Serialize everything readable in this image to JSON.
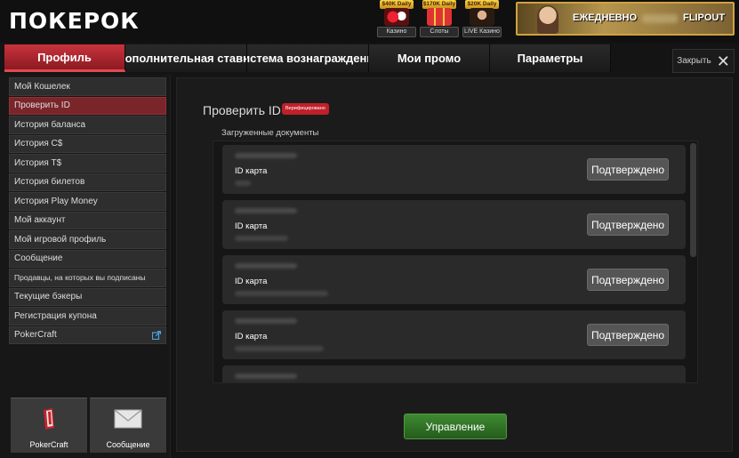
{
  "header": {
    "logo": "ПОКЕРОК",
    "games": [
      {
        "jackpot": "$40K Daily",
        "label": "Казино"
      },
      {
        "jackpot": "$170K Daily",
        "label": "Слоты"
      },
      {
        "jackpot": "$20K Daily",
        "label": "LIVE Казино"
      }
    ],
    "promo": {
      "text_left": "ЕЖЕДНЕВНО",
      "text_right": "FLIPOUT"
    }
  },
  "tabs": [
    "Профиль",
    "Дополнительная ставка",
    "Система вознаграждений",
    "Мои промо",
    "Параметры"
  ],
  "close_label": "Закрыть",
  "sidebar": {
    "items": [
      "Мой Кошелек",
      "Проверить ID",
      "История баланса",
      "История C$",
      "История T$",
      "История билетов",
      "История Play Money",
      "Мой аккаунт",
      "Мой игровой профиль",
      "Сообщение",
      "Продавцы, на которых вы подписаны",
      "Текущие бэкеры",
      "Регистрация купона",
      "PokerCraft"
    ],
    "active_index": 1,
    "shortcuts": [
      {
        "label": "PokerCraft",
        "icon": "pokercraft-icon"
      },
      {
        "label": "Сообщение",
        "icon": "envelope-icon"
      }
    ]
  },
  "main": {
    "title": "Проверить ID",
    "badge": "Верифицировано",
    "docs_label": "Загруженные документы",
    "documents": [
      {
        "type": "ID карта",
        "status": "Подтверждено"
      },
      {
        "type": "ID карта",
        "status": "Подтверждено"
      },
      {
        "type": "ID карта",
        "status": "Подтверждено"
      },
      {
        "type": "ID карта",
        "status": "Подтверждено"
      }
    ],
    "manage_label": "Управление"
  },
  "colors": {
    "accent_red": "#b8262f",
    "manage_green": "#2f6f26",
    "promo_gold": "#d1a23f"
  }
}
